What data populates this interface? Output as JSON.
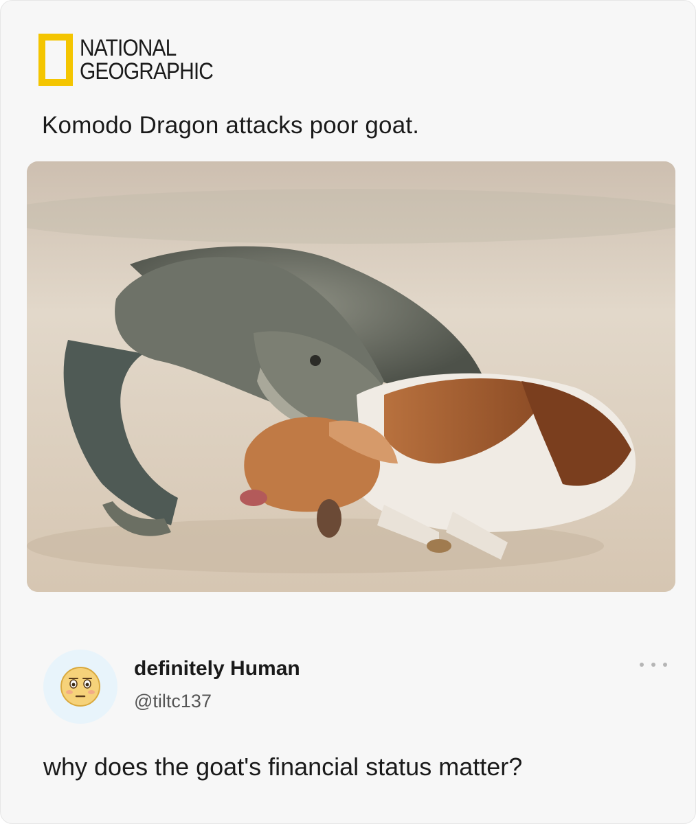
{
  "brand": {
    "line1": "NATIONAL",
    "line2": "GEOGRAPHIC",
    "logo_color": "#f4c500"
  },
  "post": {
    "title": "Komodo Dragon attacks poor goat."
  },
  "reply": {
    "display_name": "definitely Human",
    "handle": "@tiltc137",
    "text": "why does the goat's financial status matter?",
    "avatar_icon": "flushed-face-emoji",
    "more_icon": "more-dots-icon"
  }
}
